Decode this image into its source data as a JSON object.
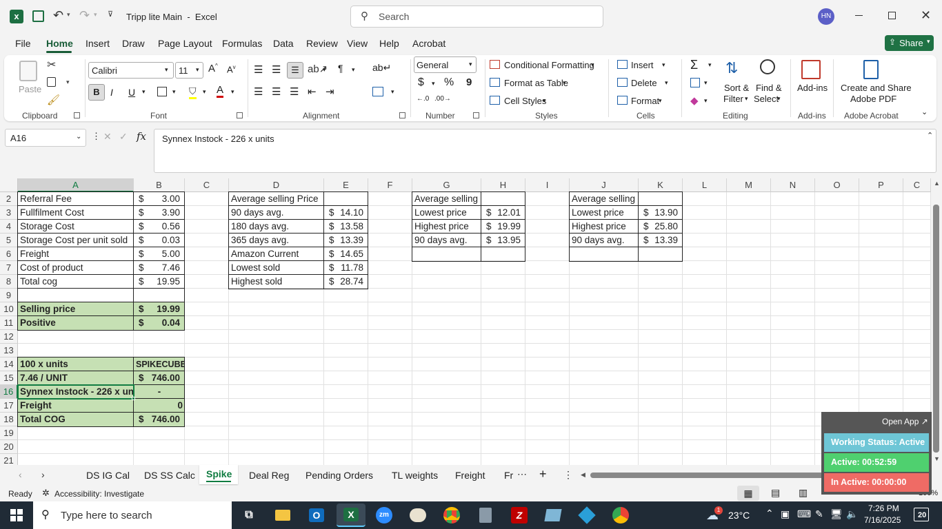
{
  "titlebar": {
    "doc_title": "Tripp lite Main  -  Excel",
    "search_placeholder": "Search",
    "avatar": "HN"
  },
  "menu": [
    "File",
    "Home",
    "Insert",
    "Draw",
    "Page Layout",
    "Formulas",
    "Data",
    "Review",
    "View",
    "Help",
    "Acrobat"
  ],
  "share_label": "Share",
  "ribbon": {
    "clipboard": {
      "paste": "Paste",
      "label": "Clipboard"
    },
    "font": {
      "name": "Calibri",
      "size": "11",
      "label": "Font",
      "bold": "B",
      "italic": "I",
      "underline": "U"
    },
    "alignment": {
      "label": "Alignment"
    },
    "number": {
      "format": "General",
      "label": "Number",
      "currency": "$",
      "percent": "%",
      "comma": "9"
    },
    "styles": {
      "conditional": "Conditional Formatting",
      "format_table": "Format as Table",
      "cell_styles": "Cell Styles",
      "label": "Styles"
    },
    "cells": {
      "insert": "Insert",
      "delete": "Delete",
      "format": "Format",
      "label": "Cells"
    },
    "editing": {
      "sort1": "Sort &",
      "sort2": "Filter",
      "find1": "Find &",
      "find2": "Select",
      "label": "Editing"
    },
    "addins": {
      "btn": "Add-ins",
      "label": "Add-ins"
    },
    "acrobat": {
      "line1": "Create and Share",
      "line2": "Adobe PDF",
      "label": "Adobe Acrobat"
    }
  },
  "formula_bar": {
    "name_box": "A16",
    "fx": "fx",
    "content": "Synnex Instock - 226 x units"
  },
  "columns": [
    "A",
    "B",
    "C",
    "D",
    "E",
    "F",
    "G",
    "H",
    "I",
    "J",
    "K",
    "L",
    "M",
    "N",
    "O",
    "P",
    "C"
  ],
  "rows": [
    "2",
    "3",
    "4",
    "5",
    "6",
    "7",
    "8",
    "9",
    "10",
    "11",
    "12",
    "13",
    "14",
    "15",
    "16",
    "17",
    "18",
    "19",
    "20",
    "21"
  ],
  "cells": {
    "a2": "Referral Fee",
    "a3": "Fullfilment Cost",
    "a4": "Storage Cost",
    "a5": "Storage Cost per unit sold",
    "a6": "Freight",
    "a7": "Cost of product",
    "a8": "Total cog",
    "b2": "3.00",
    "b3": "3.90",
    "b4": "0.56",
    "b5": "0.03",
    "b6": "5.00",
    "b7": "7.46",
    "b8": "19.95",
    "a10": "Selling price",
    "b10": "19.99",
    "a11": "Positive",
    "b11": "0.04",
    "a14": "100 x units",
    "b14": "SPIKECUBE",
    "a15": "7.46 / UNIT",
    "b15": "746.00",
    "a16": "Synnex Instock - 226 x units",
    "b16": "-",
    "a17": "Freight",
    "b17": "0",
    "a18": "Total COG",
    "b18": "746.00",
    "d2": "Average selling Price",
    "d3": "90 days avg.",
    "d4": "180 days avg.",
    "d5": "365 days avg.",
    "d6": "Amazon Current",
    "d7": "Lowest sold",
    "d8": "Highest sold",
    "e3": "14.10",
    "e4": "13.58",
    "e5": "13.39",
    "e6": "14.65",
    "e7": "11.78",
    "e8": "28.74",
    "g2": "Average selling",
    "g3": "Lowest price",
    "g4": "Highest price",
    "g5": "90 days avg.",
    "h3": "12.01",
    "h4": "19.99",
    "h5": "13.95",
    "j2": "Average selling",
    "j3": "Lowest price",
    "j4": "Highest price",
    "j5": "90 days avg.",
    "k3": "13.90",
    "k4": "25.80",
    "k5": "13.39",
    "dollar": "$"
  },
  "sheet_tabs": [
    "DS IG Cal",
    "DS SS Calc",
    "Spike",
    "Deal Reg",
    "Pending Orders",
    "TL weights",
    "Freight",
    "Fr"
  ],
  "active_tab": "Spike",
  "status": {
    "ready": "Ready",
    "accessibility": "Accessibility: Investigate",
    "zoom": "100%"
  },
  "overlay": {
    "open_app": "Open App ↗",
    "working": "Working Status: Active",
    "active": "Active: 00:52:59",
    "inactive": "In Active: 00:00:00"
  },
  "taskbar": {
    "search": "Type here to search",
    "temp": "23°C",
    "time": "7:26 PM",
    "date": "7/16/2025",
    "notif": "20",
    "weather_badge": "1"
  },
  "colors": {
    "excel_green": "#217346",
    "cell_green": "#c6e0b4",
    "share_green": "#1f7244"
  }
}
